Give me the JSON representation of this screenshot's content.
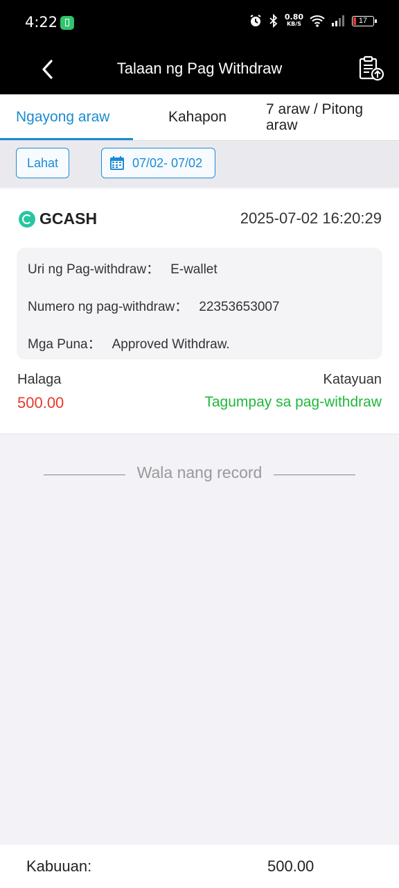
{
  "status_bar": {
    "time": "4:22",
    "speed_value": "0.80",
    "speed_unit": "KB/S",
    "battery": "17"
  },
  "header": {
    "title": "Talaan ng Pag Withdraw"
  },
  "tabs": [
    {
      "label": "Ngayong araw",
      "active": true
    },
    {
      "label": "Kahapon",
      "active": false
    },
    {
      "label": "7 araw / Pitong araw",
      "active": false
    }
  ],
  "filters": {
    "all_label": "Lahat",
    "date_range": "07/02- 07/02"
  },
  "record": {
    "provider": "GCASH",
    "datetime": "2025-07-02 16:20:29",
    "details": [
      {
        "label": "Uri ng Pag-withdraw：",
        "value": "E-wallet"
      },
      {
        "label": "Numero ng pag-withdraw：",
        "value": "22353653007"
      },
      {
        "label": "Mga Puna：",
        "value": "Approved Withdraw."
      }
    ],
    "amount_label": "Halaga",
    "amount": "500.00",
    "status_label": "Katayuan",
    "status": "Tagumpay sa pag-withdraw"
  },
  "no_more": "Wala nang record",
  "footer": {
    "total_label": "Kabuuan:",
    "total_value": "500.00"
  },
  "colors": {
    "accent": "#1a8bd2",
    "amount": "#e53a2a",
    "success": "#1fb83a"
  }
}
